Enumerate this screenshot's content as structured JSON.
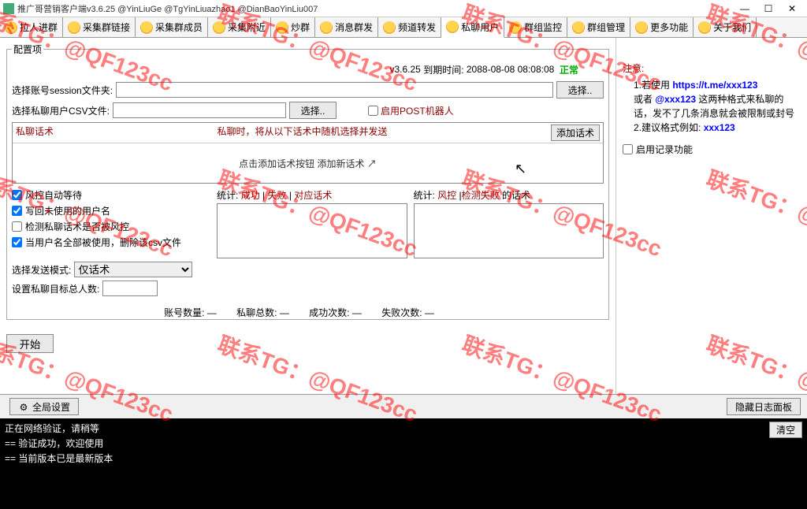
{
  "title": "推广哥营销客户端v3.6.25 @YinLiuGe @TgYinLiuazhao1 @DianBaoYinLiu007",
  "win": {
    "min": "—",
    "max": "☐",
    "close": "✕"
  },
  "tabs": [
    {
      "label": "拉人进群"
    },
    {
      "label": "采集群链接"
    },
    {
      "label": "采集群成员"
    },
    {
      "label": "采集附近"
    },
    {
      "label": "炒群"
    },
    {
      "label": "消息群发"
    },
    {
      "label": "频道转发"
    },
    {
      "label": "私聊用户",
      "active": true
    },
    {
      "label": "群组监控"
    },
    {
      "label": "群组管理"
    },
    {
      "label": "更多功能"
    },
    {
      "label": "关于我们"
    }
  ],
  "status": {
    "version": "v3.6.25",
    "expire_label": "到期时间:",
    "expire": "2088-08-08 08:08:08",
    "state": "正常"
  },
  "config": {
    "group": "配置项",
    "session_label": "选择账号session文件夹:",
    "session_btn": "选择..",
    "csv_label": "选择私聊用户CSV文件:",
    "csv_btn": "选择..",
    "post_bot": "启用POST机器人"
  },
  "talk": {
    "head_l": "私聊话术",
    "head_c": "私聊时，将从以下话术中随机选择并发送",
    "add_btn": "添加话术",
    "body": "点击添加话术按钮 添加新话术 ↗"
  },
  "checks": {
    "auto_wait": "风控自动等待",
    "write_back": "写回未使用的用户名",
    "detect": "检测私聊话术是否被风控",
    "delete_csv": "当用户名全部被使用，删除该csv文件"
  },
  "stats1": {
    "pre": "统计:",
    "a": "成功",
    "b": "失败",
    "c": "对应话术",
    "sep": " | "
  },
  "stats2": {
    "pre": "统计:",
    "a": "风控",
    "b": "检测失败",
    "c": "的话术",
    "sep": " |"
  },
  "send_mode": {
    "label": "选择发送模式:",
    "value": "仅话术"
  },
  "target_count": {
    "label": "设置私聊目标总人数:"
  },
  "counts": {
    "accounts": "账号数量: —",
    "total": "私聊总数: —",
    "success": "成功次数: —",
    "fail": "失败次数: —"
  },
  "start_btn": "开始",
  "notice": {
    "title": "注意:",
    "l1a": "1.若使用 ",
    "l1b": "https://t.me/xxx123",
    "l2a": "或者 ",
    "l2b": "@xxx123",
    "l2c": " 这两种格式来私聊的话，发不了几条消息就会被限制或封号",
    "l3a": "2.建议格式例如: ",
    "l3b": "xxx123"
  },
  "log_enable": "启用记录功能",
  "bottom": {
    "global": "全局设置",
    "hide_log": "隐藏日志面板"
  },
  "log": {
    "l1": "正在网络验证，请稍等",
    "l2": "==  验证成功，欢迎使用",
    "l3": "==  当前版本已是最新版本",
    "clear": "清空"
  },
  "watermark": "联系TG：@QF123cc"
}
